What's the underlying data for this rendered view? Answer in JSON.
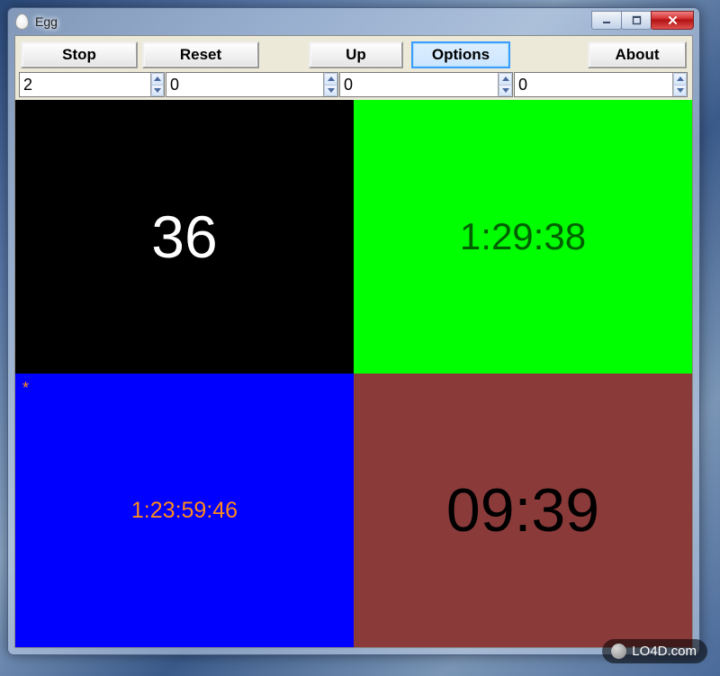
{
  "window": {
    "title": "Egg"
  },
  "toolbar": {
    "stop": "Stop",
    "reset": "Reset",
    "up": "Up",
    "options": "Options",
    "about": "About"
  },
  "spinners": {
    "s1": "2",
    "s2": "0",
    "s3": "0",
    "s4": "0"
  },
  "panels": {
    "p1": {
      "value": "36"
    },
    "p2": {
      "value": "1:29:38"
    },
    "p3": {
      "value": "1:23:59:46",
      "marker": "*"
    },
    "p4": {
      "value": "09:39"
    }
  },
  "watermark": "LO4D.com"
}
